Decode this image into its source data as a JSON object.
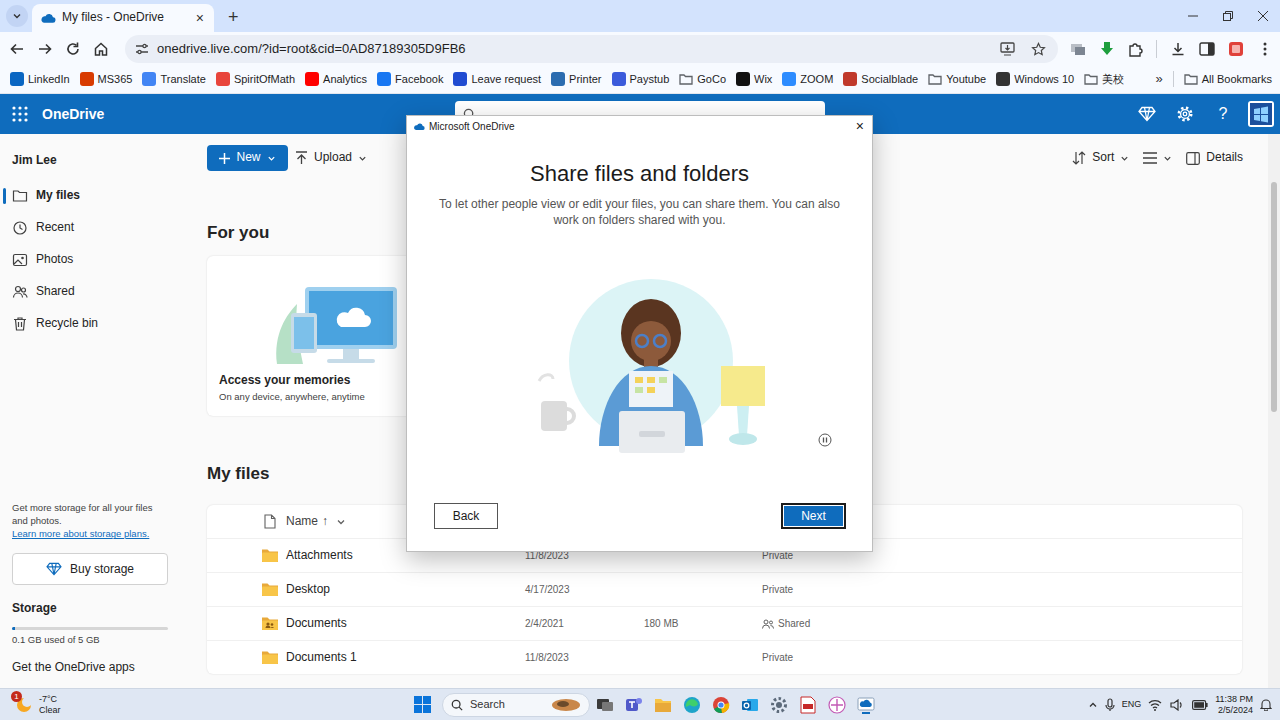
{
  "browser": {
    "tab": {
      "title": "My files - OneDrive",
      "close": "×",
      "selected": true
    },
    "new_tab": "+",
    "address": "onedrive.live.com/?id=root&cid=0AD87189305D9FB6",
    "bookmarks": [
      {
        "label": "LinkedIn",
        "kind": "site",
        "color": "#0a66c2"
      },
      {
        "label": "MS365",
        "kind": "site",
        "color": "#d83b01"
      },
      {
        "label": "Translate",
        "kind": "site",
        "color": "#4285f4"
      },
      {
        "label": "SpiritOfMath",
        "kind": "site",
        "color": "#e8453c"
      },
      {
        "label": "Analytics",
        "kind": "site",
        "color": "#ff0000"
      },
      {
        "label": "Facebook",
        "kind": "site",
        "color": "#1877f2"
      },
      {
        "label": "Leave request",
        "kind": "site",
        "color": "#1f4bd1"
      },
      {
        "label": "Printer",
        "kind": "site",
        "color": "#2b6cb0"
      },
      {
        "label": "Paystub",
        "kind": "site",
        "color": "#3b5bdb"
      },
      {
        "label": "GoCo",
        "kind": "folder",
        "color": "#5f6368"
      },
      {
        "label": "Wix",
        "kind": "site",
        "color": "#111111"
      },
      {
        "label": "ZOOM",
        "kind": "site",
        "color": "#2d8cff"
      },
      {
        "label": "Socialblade",
        "kind": "site",
        "color": "#c0392b"
      },
      {
        "label": "Youtube",
        "kind": "folder",
        "color": "#5f6368"
      },
      {
        "label": "Windows 10",
        "kind": "site",
        "color": "#333333"
      },
      {
        "label": "美校",
        "kind": "folder",
        "color": "#5f6368"
      }
    ],
    "more_bookmarks": "»",
    "all_bookmarks": "All Bookmarks"
  },
  "app": {
    "name": "OneDrive",
    "help": "?"
  },
  "sidebar": {
    "user": "Jim Lee",
    "items": [
      {
        "label": "My files",
        "selected": true
      },
      {
        "label": "Recent",
        "selected": false
      },
      {
        "label": "Photos",
        "selected": false
      },
      {
        "label": "Shared",
        "selected": false
      },
      {
        "label": "Recycle bin",
        "selected": false
      }
    ],
    "promo": "Get more storage for all your files and photos.",
    "promo_link": "Learn more about storage plans.",
    "buy_button": "Buy storage",
    "storage": {
      "title": "Storage",
      "level": 0.02,
      "reading": "0.1 GB used of 5 GB"
    },
    "apps_link": "Get the OneDrive apps"
  },
  "commands": {
    "new": "New",
    "upload": "Upload",
    "sort": "Sort",
    "details": "Details"
  },
  "for_you": {
    "title": "For you",
    "cards": [
      {
        "title": "Access your memories",
        "subtitle": "On any device, anywhere, anytime"
      }
    ]
  },
  "files": {
    "title": "My files",
    "name_column": "Name",
    "sort_arrow": "↑",
    "rows": [
      {
        "name": "Attachments",
        "modified": "11/8/2023",
        "sharing": "Private",
        "shared": false
      },
      {
        "name": "Desktop",
        "modified": "4/17/2023",
        "sharing": "Private",
        "shared": false
      },
      {
        "name": "Documents",
        "modified": "2/4/2021",
        "size": "180 MB",
        "sharing": "Shared",
        "shared": true
      },
      {
        "name": "Documents 1",
        "modified": "11/8/2023",
        "sharing": "Private",
        "shared": false
      }
    ]
  },
  "dialog": {
    "title": "Microsoft OneDrive",
    "close": "×",
    "heading": "Share files and folders",
    "body": "To let other people view or edit your files, you can share them. You can also work on folders shared with you.",
    "buttons": [
      {
        "label": "Back",
        "primary": false
      },
      {
        "label": "Next",
        "primary": true
      }
    ]
  },
  "taskbar": {
    "weather": {
      "temperature": "-7°C",
      "condition": "Clear",
      "badge": "1"
    },
    "search": "Search",
    "language": "ENG",
    "time": "11:38 PM",
    "date": "2/5/2024"
  }
}
